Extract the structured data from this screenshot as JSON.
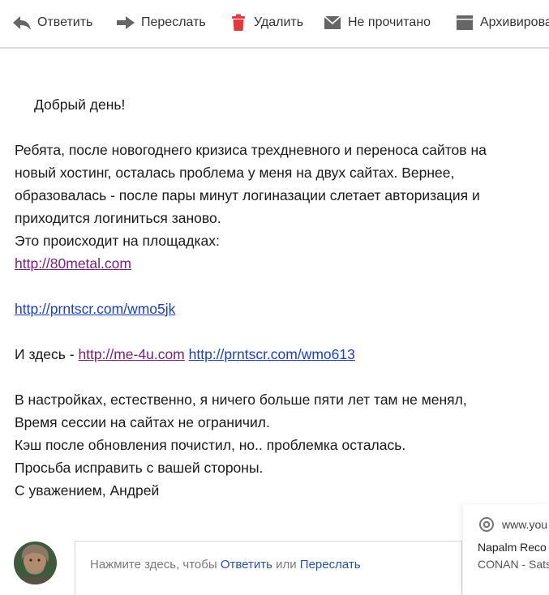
{
  "toolbar": {
    "reply_label": "Ответить",
    "forward_label": "Переслать",
    "delete_label": "Удалить",
    "unread_label": "Не прочитано",
    "archive_label": "Архивирова"
  },
  "message": {
    "greeting": "Добрый день!",
    "para1_line1": "Ребята, после новогоднего кризиса трехдневного и переноса сайтов на",
    "para1_line2": "новый хостинг, осталась проблема у меня на двух сайтах. Вернее,",
    "para1_line3": "образовалась - после пары минут логиназации слетает авторизация и",
    "para1_line4": "приходится логиниться заново.",
    "para1_line5": "Это происходит на площадках:",
    "link1": "http://80metal.com",
    "link2": "http://prntscr.com/wmo5jk",
    "here_prefix": "И здесь - ",
    "link3": "http://me-4u.com",
    "link4": "http://prntscr.com/wmo613",
    "para2_line1": "В настройках, естественно, я ничего больше пяти лет там не менял,",
    "para2_line2": "Время сессии на сайтах не ограничил.",
    "para2_line3": "Кэш после обновления почистил, но.. проблемка осталась.",
    "para2_line4": "Просьба исправить с вашей стороны.",
    "signature": "С уважением, Андрей"
  },
  "reply_area": {
    "prompt_prefix": "Нажмите здесь, чтобы ",
    "reply_link": "Ответить",
    "or_word": " или ",
    "forward_link": "Переслать"
  },
  "notification": {
    "source": "www.you",
    "title": "Napalm Reco",
    "body": "CONAN - Sats"
  },
  "colors": {
    "visited_link": "#7b1f7b",
    "link": "#1c3fc4",
    "delete_icon": "#e03a3a",
    "toolbar_icon": "#666666"
  }
}
